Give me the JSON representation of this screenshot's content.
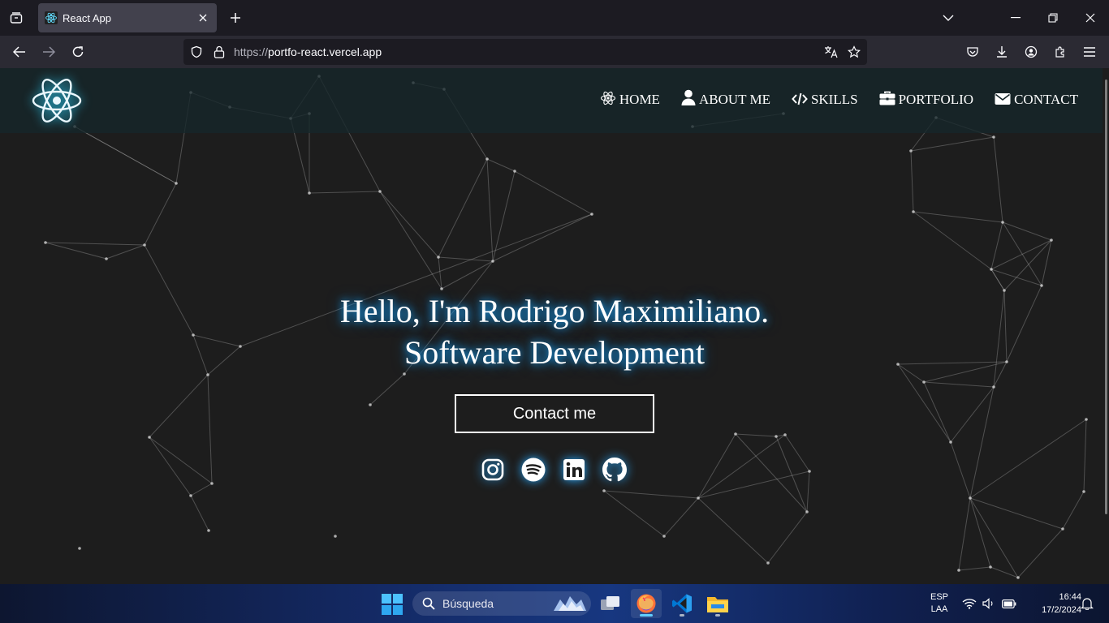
{
  "browser": {
    "tab_title": "React App",
    "url_scheme": "https://",
    "url_host": "portfo-react.vercel.app"
  },
  "site": {
    "nav": [
      {
        "label": "HOME",
        "icon": "react-atom-icon"
      },
      {
        "label": "ABOUT ME",
        "icon": "user-icon"
      },
      {
        "label": "SKILLS",
        "icon": "code-icon"
      },
      {
        "label": "PORTFOLIO",
        "icon": "briefcase-icon"
      },
      {
        "label": "CONTACT",
        "icon": "envelope-icon"
      }
    ],
    "hero_line1": "Hello, I'm Rodrigo Maximiliano.",
    "hero_line2": "Software Development",
    "cta_label": "Contact me",
    "socials": [
      "instagram-icon",
      "spotify-icon",
      "linkedin-icon",
      "github-icon"
    ],
    "accent_glow": "#1aa8ff"
  },
  "taskbar": {
    "search_placeholder": "Búsqueda",
    "lang_line1": "ESP",
    "lang_line2": "LAA",
    "time": "16:44",
    "date": "17/2/2024"
  }
}
